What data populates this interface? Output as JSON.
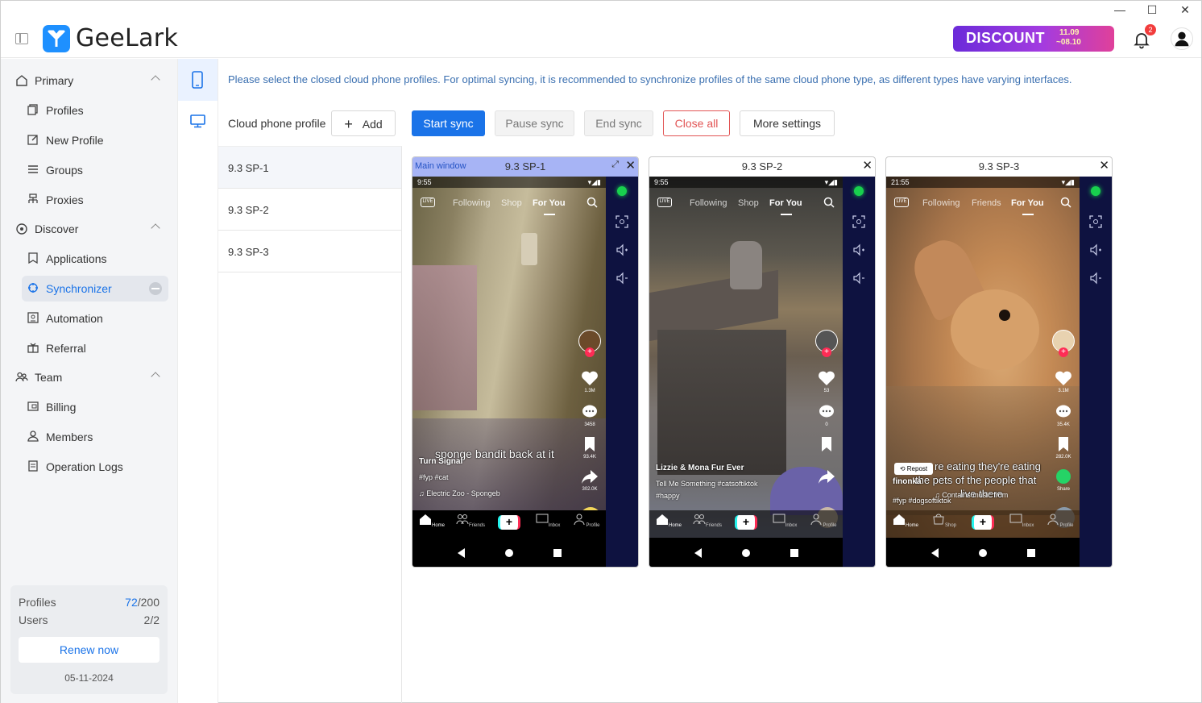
{
  "window": {
    "minimize": "—",
    "maximize": "☐",
    "close": "✕"
  },
  "header": {
    "brand": "GeeLark",
    "promo": {
      "text": "DISCOUNT",
      "date1": "11.09",
      "date2": "~08.10"
    },
    "notifications_count": "2"
  },
  "nav": {
    "groups": [
      {
        "label": "Primary",
        "items": [
          "Profiles",
          "New Profile",
          "Groups",
          "Proxies"
        ]
      },
      {
        "label": "Discover",
        "items": [
          "Applications",
          "Synchronizer",
          "Automation",
          "Referral"
        ]
      },
      {
        "label": "Team",
        "items": [
          "Billing",
          "Members",
          "Operation Logs"
        ]
      }
    ],
    "active_item": "Synchronizer",
    "stats": {
      "profiles_label": "Profiles",
      "profiles_used": "72",
      "profiles_total": "/200",
      "users_label": "Users",
      "users_value": "2/2",
      "renew": "Renew now",
      "date": "05-11-2024"
    }
  },
  "main": {
    "notice": "Please select the closed cloud phone profiles. For optimal syncing, it is recommended to synchronize profiles of the same cloud phone type, as different types have varying interfaces.",
    "profile_label": "Cloud phone profile",
    "buttons": {
      "add": "Add",
      "start": "Start sync",
      "pause": "Pause sync",
      "end": "End sync",
      "close_all": "Close all",
      "more": "More settings"
    },
    "profiles": [
      "9.3 SP-1",
      "9.3 SP-2",
      "9.3 SP-3"
    ]
  },
  "phones": [
    {
      "main_label": "Main window",
      "title": "9.3 SP-1",
      "time": "9:55",
      "tabs": [
        "Following",
        "Shop",
        "For You"
      ],
      "likes": "1.3M",
      "comments": "3458",
      "saves": "93.4K",
      "shares": "302.0K",
      "overlay": "sponge bandit back at it",
      "author": "Turn Signal",
      "tags": "#fyp #cat",
      "music": "♫ Electric Zoo - Spongeb",
      "nav": [
        "Home",
        "Friends",
        "",
        "Inbox",
        "Profile"
      ]
    },
    {
      "title": "9.3 SP-2",
      "time": "9:55",
      "tabs": [
        "Following",
        "Shop",
        "For You"
      ],
      "likes": "53",
      "comments": "0",
      "saves": "",
      "author": "Lizzie & Mona Fur Ever",
      "tags": "Tell Me Something #catsoftiktok",
      "tags2": "#happy",
      "nav": [
        "Home",
        "Friends",
        "",
        "Inbox",
        "Profile"
      ]
    },
    {
      "title": "9.3 SP-3",
      "time": "21:55",
      "tabs": [
        "Following",
        "Friends",
        "For You"
      ],
      "likes": "3.1M",
      "comments": "35.4K",
      "saves": "282.0K",
      "shares": "Share",
      "repost": "Repost",
      "overlay1": "re eating they're eating",
      "overlay2": "the pets of the people that",
      "overlay3": "live there",
      "author": "finonka",
      "tags": "#fyp #dogsoftiktok",
      "music": "♫ Contains music from",
      "nav": [
        "Home",
        "Shop",
        "",
        "Inbox",
        "Profile"
      ]
    }
  ]
}
